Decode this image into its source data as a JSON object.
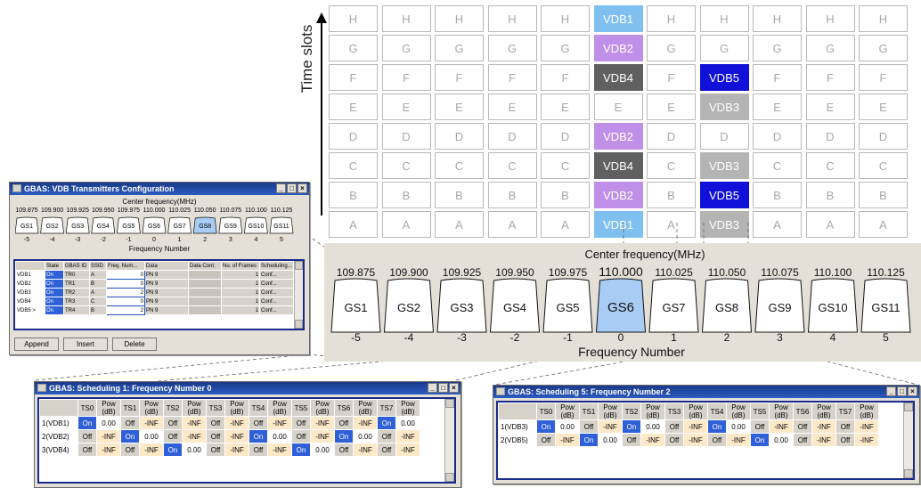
{
  "grid": {
    "axis_label": "Time slots",
    "rows": [
      "H",
      "G",
      "F",
      "E",
      "D",
      "C",
      "B",
      "A"
    ],
    "vdb_cells": [
      {
        "col": 5,
        "row": 0,
        "label": "VDB1",
        "color": "#80c0f0"
      },
      {
        "col": 5,
        "row": 1,
        "label": "VDB2",
        "color": "#c090e8"
      },
      {
        "col": 5,
        "row": 2,
        "label": "VDB4",
        "color": "#606060"
      },
      {
        "col": 5,
        "row": 4,
        "label": "VDB2",
        "color": "#c090e8"
      },
      {
        "col": 5,
        "row": 5,
        "label": "VDB4",
        "color": "#606060"
      },
      {
        "col": 5,
        "row": 6,
        "label": "VDB2",
        "color": "#c090e8"
      },
      {
        "col": 5,
        "row": 7,
        "label": "VDB1",
        "color": "#80c0f0"
      },
      {
        "col": 7,
        "row": 2,
        "label": "VDB5",
        "color": "#1010d8"
      },
      {
        "col": 7,
        "row": 3,
        "label": "VDB3",
        "color": "#b4b4b4"
      },
      {
        "col": 7,
        "row": 5,
        "label": "VDB3",
        "color": "#b4b4b4"
      },
      {
        "col": 7,
        "row": 6,
        "label": "VDB5",
        "color": "#1010d8"
      },
      {
        "col": 7,
        "row": 7,
        "label": "VDB3",
        "color": "#b4b4b4"
      }
    ]
  },
  "band": {
    "title": "Center frequency(MHz)",
    "footer": "Frequency Number",
    "freqs": [
      "109.875",
      "109.900",
      "109.925",
      "109.950",
      "109.975",
      "110.000",
      "110.025",
      "110.050",
      "110.075",
      "110.100",
      "110.125"
    ],
    "stations": [
      "GS1",
      "GS2",
      "GS3",
      "GS4",
      "GS5",
      "GS6",
      "GS7",
      "GS8",
      "GS9",
      "GS10",
      "GS11"
    ],
    "numbers": [
      "-5",
      "-4",
      "-3",
      "-2",
      "-1",
      "0",
      "1",
      "2",
      "3",
      "4",
      "5"
    ],
    "selected_index": 5
  },
  "config_window": {
    "title": "GBAS: VDB Transmitters Configuration",
    "center_label": "Center frequency(MHz)",
    "freq_label": "Frequency Number",
    "freqs": [
      "109.875",
      "109.900",
      "109.925",
      "109.950",
      "109.975",
      "110.000",
      "110.025",
      "110.050",
      "110.075",
      "110.100",
      "110.125"
    ],
    "stations": [
      "GS1",
      "GS2",
      "GS3",
      "GS4",
      "GS5",
      "GS6",
      "GS7",
      "GS8",
      "GS9",
      "GS10",
      "GS11"
    ],
    "numbers": [
      "-5",
      "-4",
      "-3",
      "-2",
      "-1",
      "0",
      "1",
      "2",
      "3",
      "4",
      "5"
    ],
    "selected_index": 7,
    "headers": [
      "",
      "State",
      "GBAS ID",
      "SSID",
      "Freq. Num...",
      "Data",
      "Data Cont.",
      "No. of Frames",
      "Scheduling..."
    ],
    "rows": [
      [
        "VDB1",
        "On",
        "TR0",
        "A",
        "0",
        "PN 9",
        "",
        "1",
        "Conf..."
      ],
      [
        "VDB2",
        "On",
        "TR1",
        "B",
        "0",
        "PN 9",
        "",
        "1",
        "Conf..."
      ],
      [
        "VDB3",
        "On",
        "TR2",
        "A",
        "2",
        "PN 9",
        "",
        "1",
        "Conf..."
      ],
      [
        "VDB4",
        "On",
        "TR3",
        "C",
        "0",
        "PN 9",
        "",
        "1",
        "Conf..."
      ],
      [
        "VDB5 >",
        "On",
        "TR4",
        "B",
        "2",
        "PN 9",
        "",
        "1",
        "Conf..."
      ]
    ],
    "buttons": [
      "Append",
      "Insert",
      "Delete"
    ]
  },
  "sched1": {
    "title": "GBAS: Scheduling 1: Frequency Number 0",
    "headers": [
      "",
      "TS0",
      "Pow (dB)",
      "TS1",
      "Pow (dB)",
      "TS2",
      "Pow (dB)",
      "TS3",
      "Pow (dB)",
      "TS4",
      "Pow (dB)",
      "TS5",
      "Pow (dB)",
      "TS6",
      "Pow (dB)",
      "TS7",
      "Pow (dB)"
    ],
    "rows": [
      [
        "1(VDB1)",
        "On",
        "0.00",
        "Off",
        "-INF",
        "Off",
        "-INF",
        "Off",
        "-INF",
        "Off",
        "-INF",
        "Off",
        "-INF",
        "Off",
        "-INF",
        "On",
        "0.00"
      ],
      [
        "2(VDB2)",
        "Off",
        "-INF",
        "On",
        "0.00",
        "Off",
        "-INF",
        "Off",
        "-INF",
        "On",
        "0.00",
        "Off",
        "-INF",
        "On",
        "0.00",
        "Off",
        "-INF"
      ],
      [
        "3(VDB4)",
        "Off",
        "-INF",
        "Off",
        "-INF",
        "On",
        "0.00",
        "Off",
        "-INF",
        "Off",
        "-INF",
        "On",
        "0.00",
        "Off",
        "-INF",
        "Off",
        "-INF"
      ]
    ]
  },
  "sched5": {
    "title": "GBAS: Scheduling 5: Frequency Number 2",
    "headers": [
      "",
      "TS0",
      "Pow (dB)",
      "TS1",
      "Pow (dB)",
      "TS2",
      "Pow (dB)",
      "TS3",
      "Pow (dB)",
      "TS4",
      "Pow (dB)",
      "TS5",
      "Pow (dB)",
      "TS6",
      "Pow (dB)",
      "TS7",
      "Pow (dB)"
    ],
    "rows": [
      [
        "1(VDB3)",
        "On",
        "0.00",
        "Off",
        "-INF",
        "On",
        "0.00",
        "Off",
        "-INF",
        "On",
        "0.00",
        "Off",
        "-INF",
        "Off",
        "-INF",
        "Off",
        "-INF"
      ],
      [
        "2(VDB5)",
        "Off",
        "-INF",
        "On",
        "0.00",
        "Off",
        "-INF",
        "Off",
        "-INF",
        "Off",
        "-INF",
        "On",
        "0.00",
        "Off",
        "-INF",
        "Off",
        "-INF"
      ]
    ]
  }
}
